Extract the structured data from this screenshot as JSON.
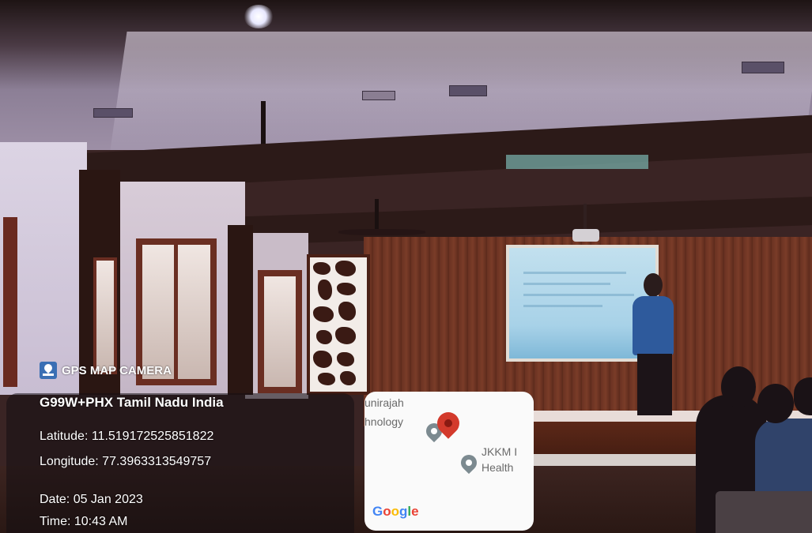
{
  "overlay": {
    "app_name": "GPS MAP CAMERA",
    "address": "G99W+PHX  Tamil Nadu  India",
    "latitude": "Latitude: 11.519172525851822",
    "longitude": "Longitude: 77.3963313549757",
    "date": "Date: 05 Jan 2023",
    "time": "Time: 10:43 AM"
  },
  "map": {
    "label_top": "unirajah",
    "label_mid": "hnology",
    "label_right_1": "JKKM I",
    "label_right_2": "Health",
    "provider": "Google",
    "provider_colors": [
      "#4285F4",
      "#EA4335",
      "#FBBC05",
      "#4285F4",
      "#34A853",
      "#EA4335"
    ]
  },
  "icons": {
    "app": "gps-map-camera-icon",
    "current_location": "red-map-pin-icon",
    "places": "gray-map-pin-icon"
  }
}
